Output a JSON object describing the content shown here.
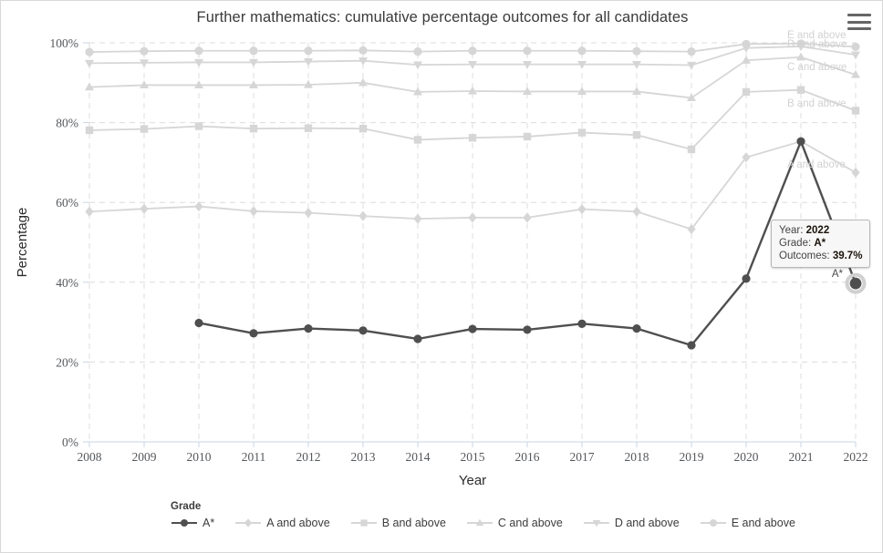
{
  "chart_data": {
    "type": "line",
    "title": "Further mathematics: cumulative percentage outcomes for all candidates",
    "xlabel": "Year",
    "ylabel": "Percentage",
    "x": [
      2008,
      2009,
      2010,
      2011,
      2012,
      2013,
      2014,
      2015,
      2016,
      2017,
      2018,
      2019,
      2020,
      2021,
      2022
    ],
    "xticklabels": [
      "2008",
      "2009",
      "2010",
      "2011",
      "2012",
      "2013",
      "2014",
      "2015",
      "2016",
      "2017",
      "2018",
      "2019",
      "2020",
      "2021",
      "2022"
    ],
    "yticklabels": [
      "0%",
      "20%",
      "40%",
      "60%",
      "80%",
      "100%"
    ],
    "yticks": [
      0,
      20,
      40,
      60,
      80,
      100
    ],
    "ylim": [
      0,
      100
    ],
    "xlim": [
      2008,
      2022
    ],
    "grid": true,
    "legend_position": "bottom",
    "legend_title": "Grade",
    "series": [
      {
        "name": "A*",
        "marker": "circle",
        "color": "#4f4f4f",
        "values": [
          null,
          null,
          29.8,
          27.2,
          28.4,
          27.9,
          25.8,
          28.3,
          28.1,
          29.6,
          28.4,
          24.2,
          40.9,
          75.3,
          39.7
        ]
      },
      {
        "name": "A and above",
        "marker": "diamond",
        "color": "#d6d6d6",
        "values": [
          57.7,
          58.4,
          59.0,
          57.8,
          57.4,
          56.6,
          55.9,
          56.2,
          56.2,
          58.3,
          57.7,
          53.3,
          71.3,
          75.3,
          67.5
        ]
      },
      {
        "name": "B and above",
        "marker": "square",
        "color": "#d6d6d6",
        "values": [
          78.1,
          78.4,
          79.1,
          78.5,
          78.6,
          78.5,
          75.7,
          76.2,
          76.5,
          77.5,
          76.9,
          73.3,
          87.7,
          88.2,
          83.0
        ]
      },
      {
        "name": "C and above",
        "marker": "triangle-up",
        "color": "#d6d6d6",
        "values": [
          88.9,
          89.4,
          89.4,
          89.4,
          89.5,
          90.0,
          87.7,
          87.9,
          87.8,
          87.8,
          87.8,
          86.2,
          95.6,
          96.4,
          92.0
        ]
      },
      {
        "name": "D and above",
        "marker": "triangle-down",
        "color": "#d6d6d6",
        "values": [
          94.9,
          95.0,
          95.1,
          95.1,
          95.3,
          95.5,
          94.5,
          94.6,
          94.6,
          94.6,
          94.6,
          94.4,
          98.7,
          99.1,
          97.0
        ]
      },
      {
        "name": "E and above",
        "marker": "circle",
        "color": "#d6d6d6",
        "values": [
          97.7,
          97.9,
          98.0,
          98.0,
          98.0,
          98.1,
          97.8,
          98.0,
          98.0,
          98.0,
          97.9,
          97.8,
          99.7,
          99.8,
          99.0
        ]
      }
    ],
    "end_labels": [
      {
        "text": "E and above",
        "series": "E and above"
      },
      {
        "text": "D and above",
        "series": "D and above"
      },
      {
        "text": "C and above",
        "series": "C and above"
      },
      {
        "text": "B and above",
        "series": "B and above"
      },
      {
        "text": "A and above",
        "series": "A and above"
      }
    ],
    "highlighted_point": {
      "series": "A*",
      "label": "A*",
      "year": 2022,
      "value": 39.7
    }
  },
  "tooltip": {
    "year_key": "Year: ",
    "year_value": "2022",
    "grade_key": "Grade: ",
    "grade_value": "A*",
    "outcomes_key": "Outcomes: ",
    "outcomes_value": "39.7%"
  },
  "toolbar": {
    "menu_icon": "hamburger-menu-icon"
  },
  "colors": {
    "active_series": "#4f4f4f",
    "inactive_series": "#d6d6d6",
    "grid": "#dcdcdc",
    "axis": "#c9d4e6",
    "tooltip_bg": "#f7f7f7",
    "tooltip_border": "#b8b8b8"
  }
}
